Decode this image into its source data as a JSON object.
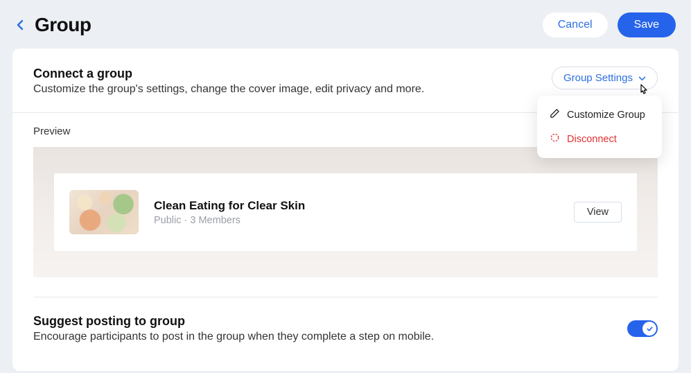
{
  "header": {
    "title": "Group",
    "cancel_label": "Cancel",
    "save_label": "Save"
  },
  "connect": {
    "title": "Connect a group",
    "desc": "Customize the group's settings, change the cover image, edit privacy and more.",
    "settings_label": "Group Settings"
  },
  "dropdown": {
    "customize": "Customize Group",
    "disconnect": "Disconnect"
  },
  "preview": {
    "label": "Preview",
    "group_name": "Clean Eating for Clear Skin",
    "meta": "Public · 3 Members",
    "view_label": "View"
  },
  "suggest": {
    "title": "Suggest posting to group",
    "desc": "Encourage participants to post in the group when they complete a step on mobile.",
    "enabled": true
  }
}
